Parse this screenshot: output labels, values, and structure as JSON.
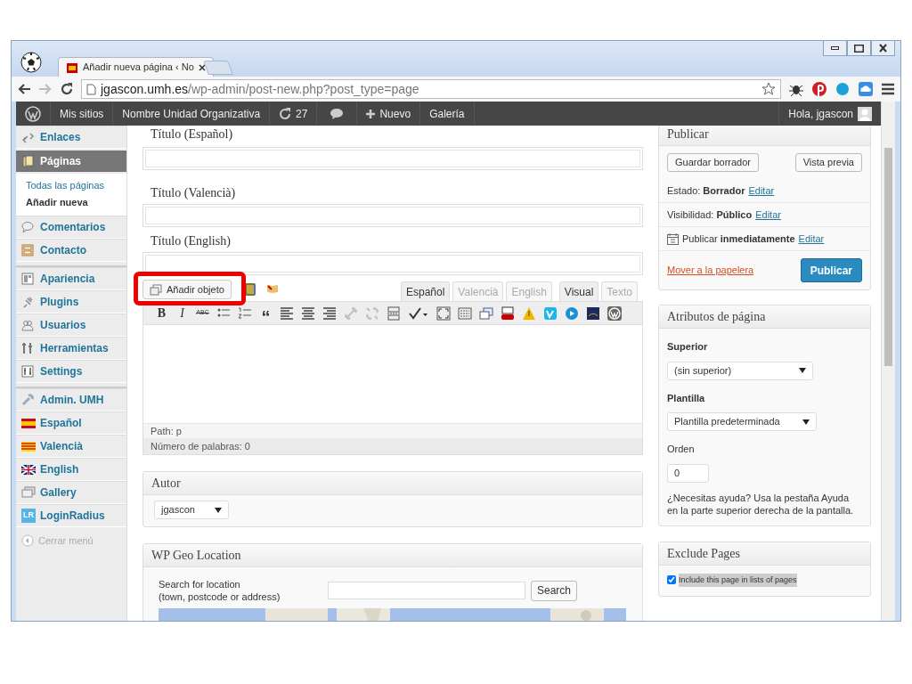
{
  "browser": {
    "tab_title": "Añadir nueva página ‹ No",
    "url_host": "jgascon.umh.es",
    "url_path": "/wp-admin/post-new.php?post_type=page"
  },
  "admin_bar": {
    "items": [
      {
        "kind": "logo"
      },
      {
        "kind": "text",
        "label": "Mis sitios"
      },
      {
        "kind": "text",
        "label": "Nombre Unidad Organizativa"
      },
      {
        "kind": "updates",
        "label": "27"
      },
      {
        "kind": "comments"
      },
      {
        "kind": "new",
        "label": "Nuevo"
      },
      {
        "kind": "text",
        "label": "Galería"
      }
    ],
    "greeting": "Hola, jgascon"
  },
  "sidebar": {
    "groups": [
      {
        "items": [
          {
            "label": "Enlaces",
            "selected": false
          },
          {
            "label": "Páginas",
            "selected": true,
            "children": [
              {
                "label": "Todas las páginas",
                "selected": false
              },
              {
                "label": "Añadir nueva",
                "selected": true
              }
            ]
          },
          {
            "label": "Comentarios",
            "selected": false
          },
          {
            "label": "Contacto",
            "selected": false
          }
        ]
      },
      {
        "items": [
          {
            "label": "Apariencia",
            "selected": false
          },
          {
            "label": "Plugins",
            "selected": false
          },
          {
            "label": "Usuarios",
            "selected": false
          },
          {
            "label": "Herramientas",
            "selected": false
          },
          {
            "label": "Settings",
            "selected": false
          }
        ]
      },
      {
        "items": [
          {
            "label": "Admin. UMH",
            "selected": false
          },
          {
            "label": "Español",
            "selected": false
          },
          {
            "label": "Valencià",
            "selected": false
          },
          {
            "label": "English",
            "selected": false
          },
          {
            "label": "Gallery",
            "selected": false
          },
          {
            "label": "LoginRadius",
            "selected": false,
            "icon_text": "LR"
          }
        ]
      }
    ],
    "collapse": "Cerrar menú"
  },
  "title_fields": [
    {
      "label": "Título (Español)"
    },
    {
      "label": "Título (Valencià)"
    },
    {
      "label": "Título (English)"
    }
  ],
  "editor": {
    "media_button": "Añadir objeto",
    "language_tabs": [
      {
        "label": "Español",
        "selected": true
      },
      {
        "label": "Valencià",
        "selected": false
      },
      {
        "label": "English",
        "selected": false
      }
    ],
    "mode_tabs": [
      {
        "label": "Visual",
        "selected": true
      },
      {
        "label": "Texto",
        "selected": false
      }
    ],
    "toolbar": [
      {
        "kind": "glyph",
        "label": "B",
        "disabled": false
      },
      {
        "kind": "glyph",
        "label": "I",
        "disabled": false
      },
      {
        "kind": "glyph",
        "label": "ABC",
        "disabled": false
      },
      {
        "kind": "icon",
        "disabled": false
      },
      {
        "kind": "icon",
        "disabled": false
      },
      {
        "kind": "glyph",
        "label": "“",
        "disabled": false
      },
      {
        "kind": "icon",
        "disabled": false
      },
      {
        "kind": "icon",
        "disabled": false
      },
      {
        "kind": "icon",
        "disabled": false
      },
      {
        "kind": "icon",
        "disabled": true
      },
      {
        "kind": "icon",
        "disabled": true
      },
      {
        "kind": "icon",
        "disabled": false
      },
      {
        "kind": "icon",
        "disabled": false
      },
      {
        "kind": "icon",
        "disabled": false
      },
      {
        "kind": "icon",
        "disabled": false
      },
      {
        "kind": "icon",
        "disabled": false
      },
      {
        "kind": "icon",
        "disabled": false
      },
      {
        "kind": "icon",
        "disabled": false
      },
      {
        "kind": "icon",
        "disabled": false
      },
      {
        "kind": "icon",
        "disabled": false
      },
      {
        "kind": "icon",
        "disabled": false
      },
      {
        "kind": "icon",
        "disabled": false
      }
    ],
    "path": "Path: p",
    "word_count": "Número de palabras: 0"
  },
  "author_box": {
    "title": "Autor",
    "value": "jgascon"
  },
  "geo_box": {
    "title": "WP Geo Location",
    "search_label_lines": [
      "Search for location",
      "(town, postcode or address)"
    ],
    "button": "Search"
  },
  "publish_box": {
    "title": "Publicar",
    "save_draft": "Guardar borrador",
    "preview": "Vista previa",
    "rows": [
      {
        "kind": "plain",
        "text": "Estado: **Borrador**",
        "link": "Editar"
      },
      {
        "kind": "plain",
        "text": "Visibilidad: **Público**",
        "link": "Editar"
      },
      {
        "kind": "calendar",
        "text": "Publicar **inmediatamente**",
        "link": "Editar"
      }
    ],
    "trash": "Mover a la papelera",
    "publish": "Publicar"
  },
  "attributes_box": {
    "title": "Atributos de página",
    "parent_label": "Superior",
    "parent_value": "(sin superior)",
    "template_label": "Plantilla",
    "template_value": "Plantilla predeterminada",
    "order_label": "Orden",
    "order_value": "0",
    "help": "¿Necesitas ayuda? Usa la pestaña Ayuda en la parte superior derecha de la pantalla."
  },
  "exclude_box": {
    "title": "Exclude Pages",
    "checkbox": {
      "label": "Include this page in lists of pages",
      "checked": true
    }
  }
}
